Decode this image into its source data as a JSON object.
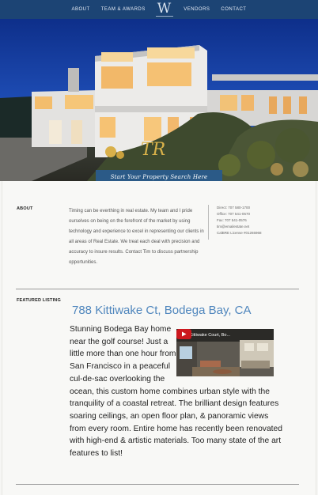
{
  "nav": {
    "items": [
      {
        "label": "ABOUT"
      },
      {
        "label": "TEAM & AWARDS"
      },
      {
        "logo": "W"
      },
      {
        "label": "VENDORS"
      },
      {
        "label": "CONTACT"
      }
    ]
  },
  "hero": {
    "brand_mark": "TR",
    "cta_label": "Start Your Property Search Here"
  },
  "about": {
    "label": "ABOUT",
    "body": "Timing can be everthing in real estate. My team and I pride ourselves on being on the forefront of the market by using technology and experience to excel in representing our clients in all areas of Real Estate. We treat each deal with precision and accuracy to insure results. Contact Tim to discuss partnership opportunities.",
    "contact": {
      "direct": "Direct: 707 580-1700",
      "office": "Office: 707 541-0570",
      "fax": "Fax: 707 541-0576",
      "email": "tim@emailestate.net",
      "license": "CalBRE License #01265968"
    }
  },
  "featured": {
    "label": "FEATURED LISTING",
    "title": "788 Kittiwake Ct, Bodega Bay, CA",
    "description": "Stunning Bodega Bay home near the golf course! Just a little more than one hour from San Francisco in a peaceful cul-de-sac overlooking the ocean, this custom home combines urban style with the tranquility of a coastal retreat. The brilliant design features soaring ceilings, an open floor plan, & panoramic views from every room. Entire home has recently been renovated with high-end & artistic materials. Too many state of the art features to list!",
    "video": {
      "title": "788 Kittiwake Court, Bo..."
    }
  },
  "colors": {
    "nav_bg": "#1c4474",
    "cta_bg": "#2b5a87",
    "title_blue": "#4f86bd",
    "logo_gold": "#d9b24a"
  }
}
